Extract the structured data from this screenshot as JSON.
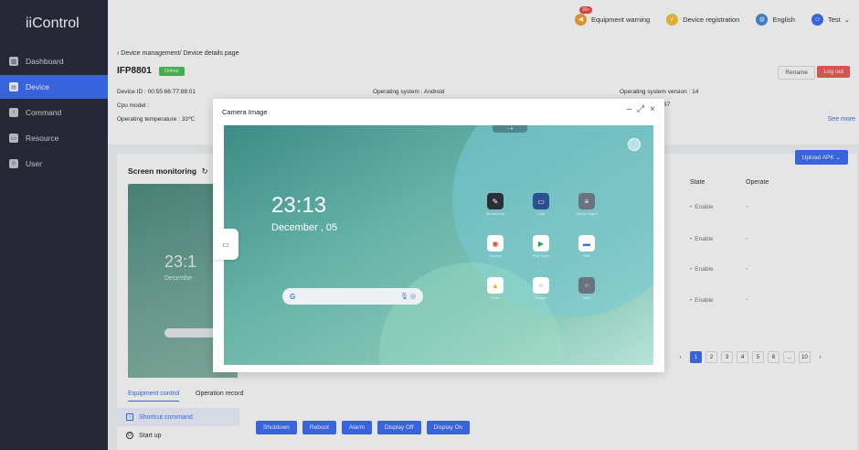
{
  "app": {
    "title": "iiControl"
  },
  "sidebar": {
    "items": [
      {
        "label": "Dashboard",
        "icon": "dashboard-icon",
        "active": false
      },
      {
        "label": "Device",
        "icon": "device-icon",
        "active": true
      },
      {
        "label": "Command",
        "icon": "command-icon",
        "active": false
      },
      {
        "label": "Resource",
        "icon": "resource-icon",
        "active": false
      },
      {
        "label": "User",
        "icon": "user-icon",
        "active": false
      }
    ]
  },
  "topbar": {
    "warning_label": "Equipment warning",
    "warning_badge": "99+",
    "registration_label": "Device registration",
    "language_label": "English",
    "user_label": "Test"
  },
  "panel": {
    "breadcrumb": "Device management/ Device details page",
    "device_name": "IFP8801",
    "status": "Online",
    "rename_label": "Rename",
    "logout_label": "Log out",
    "device_id": "Device ID : 00:55:66:77:88:01",
    "os": "Operating system : Android",
    "os_version": "Operating system version : 14",
    "cpu_model": "Cpu model :",
    "temperature": "Operating temperature : 33℃",
    "partial_value": "67",
    "see_more": "See more"
  },
  "monitor": {
    "title": "Screen monitoring",
    "upload_label": "Upload APK",
    "preview_time": "23:1",
    "preview_date": "Decembe",
    "columns": {
      "state": "State",
      "operate": "Operate"
    },
    "rows": [
      {
        "state": "Enable",
        "operate": "-"
      },
      {
        "state": "Enable",
        "operate": "-"
      },
      {
        "state": "Enable",
        "operate": "-"
      },
      {
        "state": "Enable",
        "operate": "-"
      }
    ],
    "pages": [
      "1",
      "2",
      "3",
      "4",
      "5",
      "6",
      "…",
      "10"
    ],
    "current_page": "1"
  },
  "bottom": {
    "tabs": [
      "Equipment control",
      "Operation record"
    ],
    "menu": [
      "Shortcut command",
      "Start up"
    ],
    "buttons": [
      "Shutdown",
      "Reboot",
      "Alarm",
      "Display Off",
      "Display On"
    ]
  },
  "modal": {
    "title": "Camera Image",
    "screen": {
      "time": "23:13",
      "date": "December , 05",
      "pill_text": "",
      "search_placeholder": "G",
      "apps": [
        {
          "label": "Whiteboard",
          "color": "#2b2f36",
          "glyph": "✎"
        },
        {
          "label": "Cast",
          "color": "#2d4f8f",
          "glyph": "▭"
        },
        {
          "label": "Device Mgmt",
          "color": "#6a7480",
          "glyph": "≡"
        },
        {
          "label": "Chrome",
          "color": "#ffffff",
          "glyph": "◉"
        },
        {
          "label": "Play Store",
          "color": "#ffffff",
          "glyph": "▶"
        },
        {
          "label": "Files",
          "color": "#ffffff",
          "glyph": "▬"
        },
        {
          "label": "Drive",
          "color": "#ffffff",
          "glyph": "▲"
        },
        {
          "label": "Google",
          "color": "#ffffff",
          "glyph": "⁘"
        },
        {
          "label": "More",
          "color": "#6a7480",
          "glyph": "⁘"
        }
      ]
    }
  }
}
